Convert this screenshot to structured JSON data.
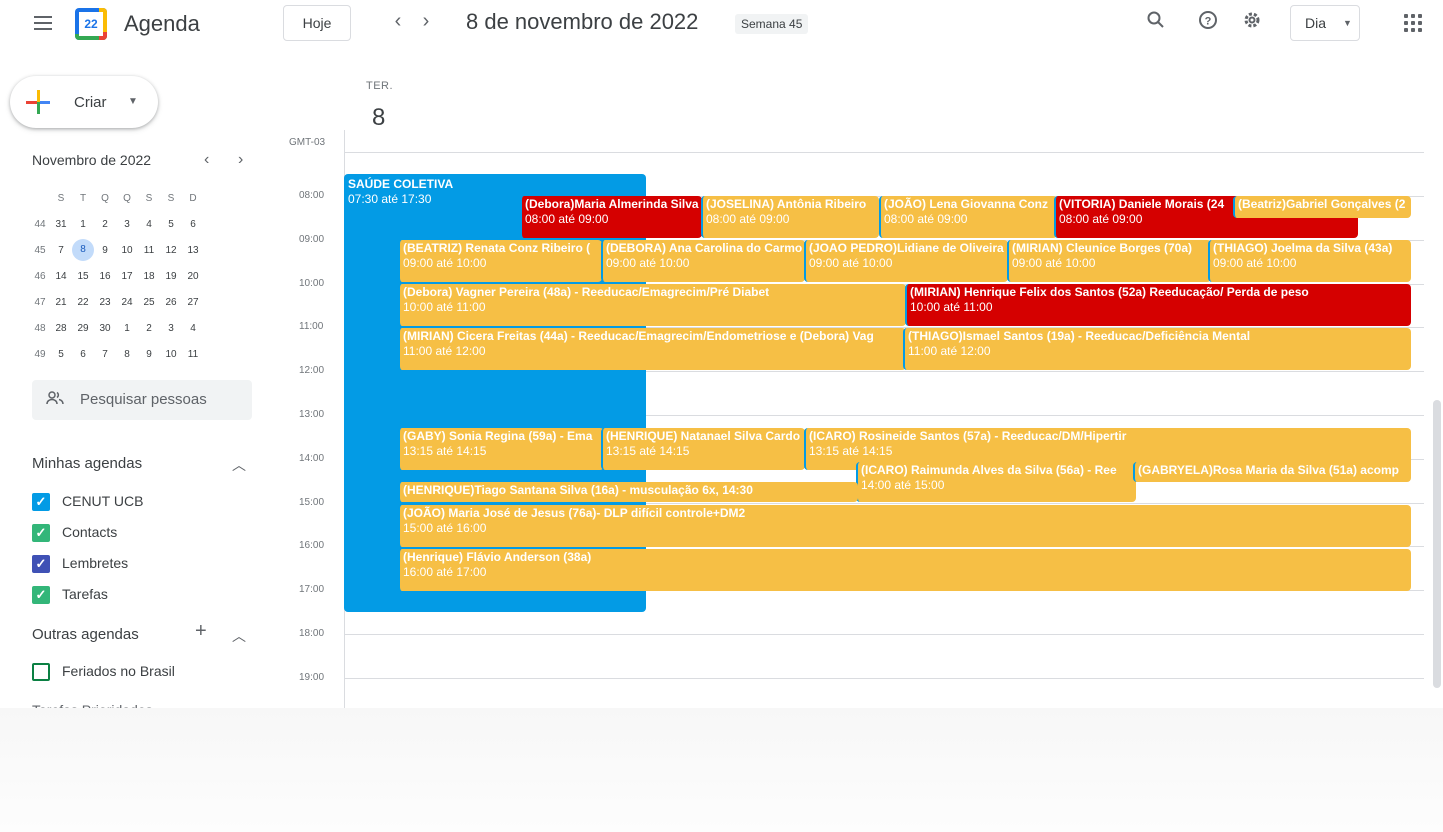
{
  "header": {
    "app_name": "Agenda",
    "logo_day": "22",
    "today_button": "Hoje",
    "prev_arrow": "‹",
    "next_arrow": "›",
    "date_title": "8 de novembro de 2022",
    "week_badge": "Semana 45",
    "view_selector": "Dia",
    "icons": [
      "menu-icon",
      "search-icon",
      "help-icon",
      "settings-icon",
      "apps-icon"
    ]
  },
  "sidebar": {
    "create_label": "Criar",
    "mini_calendar": {
      "title": "Novembro de 2022",
      "weekday_headers": [
        "S",
        "T",
        "Q",
        "Q",
        "S",
        "S",
        "D"
      ],
      "weeks": [
        {
          "week": "44",
          "days": [
            "31",
            "1",
            "2",
            "3",
            "4",
            "5",
            "6"
          ]
        },
        {
          "week": "45",
          "days": [
            "7",
            "8",
            "9",
            "10",
            "11",
            "12",
            "13"
          ]
        },
        {
          "week": "46",
          "days": [
            "14",
            "15",
            "16",
            "17",
            "18",
            "19",
            "20"
          ]
        },
        {
          "week": "47",
          "days": [
            "21",
            "22",
            "23",
            "24",
            "25",
            "26",
            "27"
          ]
        },
        {
          "week": "48",
          "days": [
            "28",
            "29",
            "30",
            "1",
            "2",
            "3",
            "4"
          ]
        },
        {
          "week": "49",
          "days": [
            "5",
            "6",
            "7",
            "8",
            "9",
            "10",
            "11"
          ]
        }
      ],
      "selected_day": "8"
    },
    "search_people_placeholder": "Pesquisar pessoas",
    "my_calendars_title": "Minhas agendas",
    "my_calendars": [
      {
        "label": "CENUT UCB",
        "color": "#039be5",
        "checked": true
      },
      {
        "label": "Contacts",
        "color": "#33b679",
        "checked": true
      },
      {
        "label": "Lembretes",
        "color": "#3f51b5",
        "checked": true
      },
      {
        "label": "Tarefas",
        "color": "#33b679",
        "checked": true
      }
    ],
    "other_calendars_title": "Outras agendas",
    "other_calendars": [
      {
        "label": "Feriados no Brasil",
        "color": "#0b8043",
        "checked": false
      }
    ],
    "cut_off_label": "Tarefas Prioridades"
  },
  "day_view": {
    "day_name": "TER.",
    "day_number": "8",
    "timezone": "GMT-03",
    "hours": [
      "08:00",
      "09:00",
      "10:00",
      "11:00",
      "12:00",
      "13:00",
      "14:00",
      "15:00",
      "16:00",
      "17:00",
      "18:00",
      "19:00"
    ]
  },
  "events": [
    {
      "title": "SAÚDE COLETIVA",
      "time": "07:30 até 17:30",
      "color": "blue"
    },
    {
      "title": "(Debora)Maria Almerinda Silva",
      "time": "08:00 até 09:00",
      "color": "red"
    },
    {
      "title": "(JOSELINA) Antônia Ribeiro",
      "time": "08:00 até 09:00",
      "color": "yellow"
    },
    {
      "title": "(JOÃO) Lena Giovanna Conz",
      "time": "08:00 até 09:00",
      "color": "yellow"
    },
    {
      "title": "(VITORIA) Daniele Morais (24",
      "time": "08:00 até 09:00",
      "color": "red"
    },
    {
      "title": "(Beatriz)Gabriel Gonçalves (2",
      "time": "",
      "color": "yellow"
    },
    {
      "title": "(BEATRIZ) Renata Conz Ribeiro (",
      "time": "09:00 até 10:00",
      "color": "yellow"
    },
    {
      "title": "(DEBORA) Ana Carolina do Carmo",
      "time": "09:00 até 10:00",
      "color": "yellow"
    },
    {
      "title": "(JOAO PEDRO)Lidiane de Oliveira",
      "time": "09:00 até 10:00",
      "color": "yellow"
    },
    {
      "title": "(MIRIAN) Cleunice Borges (70a)",
      "time": "09:00 até 10:00",
      "color": "yellow"
    },
    {
      "title": "(THIAGO) Joelma da Silva (43a)",
      "time": "09:00 até 10:00",
      "color": "yellow"
    },
    {
      "title": "(Debora) Vagner Pereira (48a) - Reeducac/Emagrecim/Pré Diabet",
      "time": "10:00 até 11:00",
      "color": "yellow"
    },
    {
      "title": "(MIRIAN) Henrique Felix dos Santos (52a) Reeducação/ Perda de peso",
      "time": "10:00 até 11:00",
      "color": "red"
    },
    {
      "title": "(MIRIAN) Cicera Freitas (44a) - Reeducac/Emagrecim/Endometriose e (Debora) Vag",
      "time": "11:00 até 12:00",
      "color": "yellow"
    },
    {
      "title": "(THIAGO)Ismael Santos (19a) - Reeducac/Deficiência Mental",
      "time": "11:00 até 12:00",
      "color": "yellow"
    },
    {
      "title": "(GABY) Sonia Regina (59a) - Ema",
      "time": "13:15 até 14:15",
      "color": "yellow"
    },
    {
      "title": "(HENRIQUE) Natanael Silva Cardo",
      "time": "13:15 até 14:15",
      "color": "yellow"
    },
    {
      "title": "(ICARO) Rosineide Santos (57a) - Reeducac/DM/Hipertir",
      "time": "13:15 até 14:15",
      "color": "yellow"
    },
    {
      "title": "(ICARO) Raimunda Alves da Silva (56a) - Ree",
      "time": "14:00 até 15:00",
      "color": "yellow"
    },
    {
      "title": "(GABRYELA)Rosa Maria da Silva (51a) acomp",
      "time": "",
      "color": "yellow"
    },
    {
      "title": "(HENRIQUE)Tiago Santana Silva (16a) - musculação 6x, 14:30",
      "time": "",
      "color": "yellow"
    },
    {
      "title": "(JOÃO) Maria José de Jesus (76a)- DLP difícil controle+DM2",
      "time": "15:00 até 16:00",
      "color": "yellow"
    },
    {
      "title": "(Henrique) Flávio Anderson (38a)",
      "time": "16:00 até 17:00",
      "color": "yellow"
    }
  ]
}
